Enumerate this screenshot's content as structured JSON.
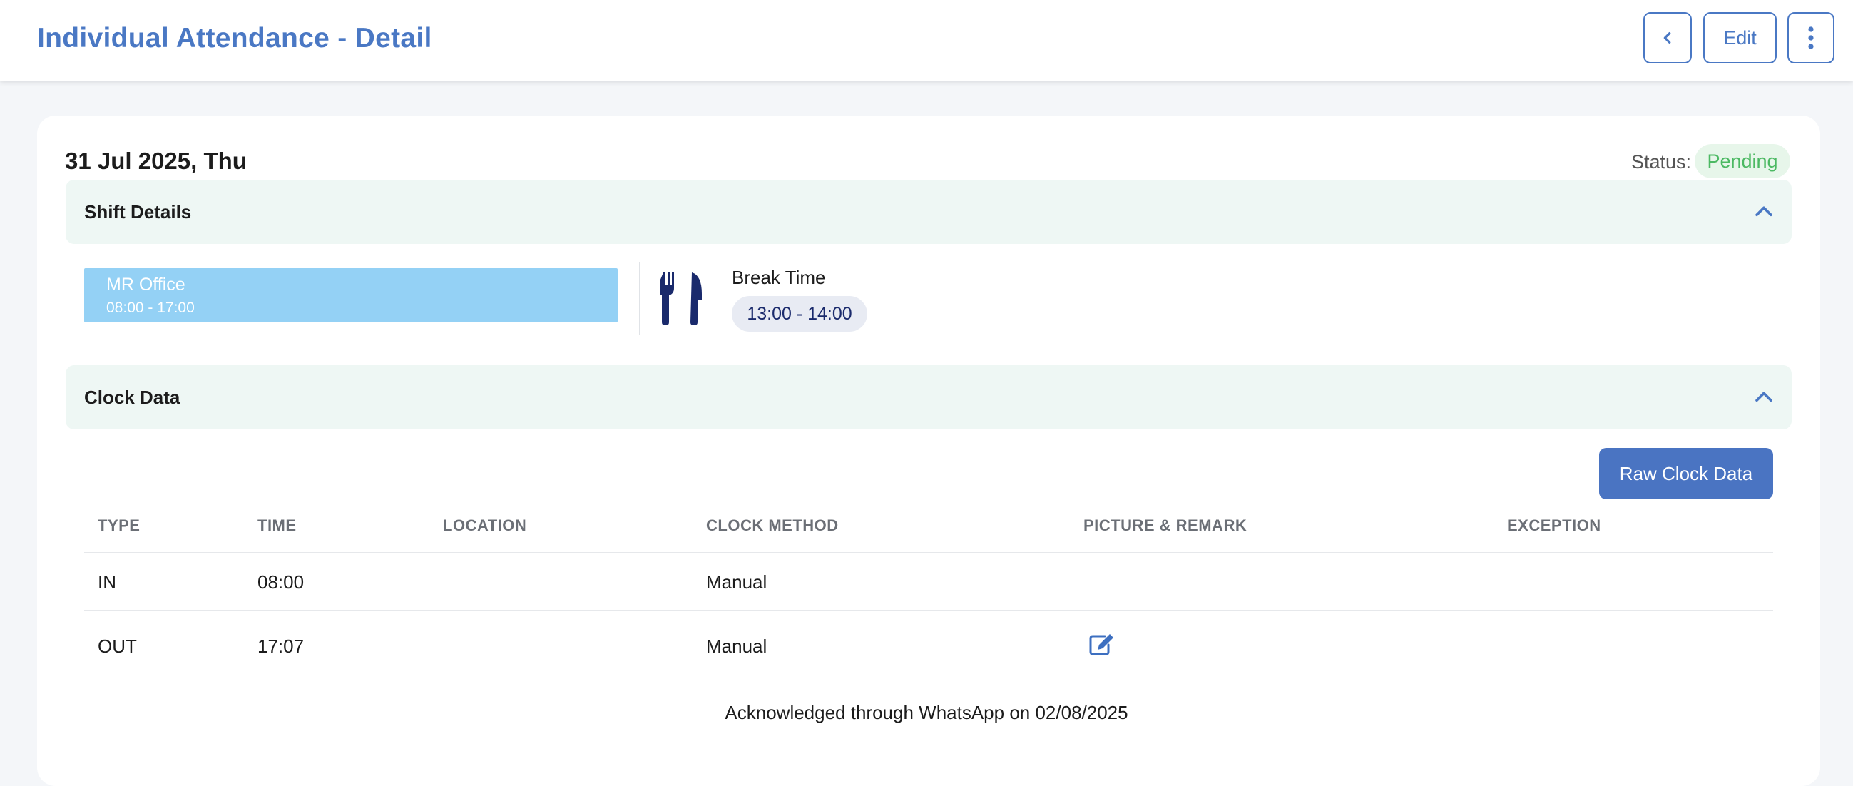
{
  "header": {
    "title": "Individual Attendance - Detail",
    "back_icon": "chevron-left-icon",
    "edit_label": "Edit",
    "more_icon": "vertical-dots-icon"
  },
  "record": {
    "date": "31 Jul 2025, Thu",
    "status_label": "Status:",
    "status_value": "Pending"
  },
  "shift_details": {
    "section_label": "Shift Details",
    "shift_name": "MR Office",
    "shift_time": "08:00 - 17:00",
    "break_label": "Break Time",
    "break_time": "13:00 - 14:00"
  },
  "clock_data": {
    "section_label": "Clock Data",
    "raw_button_label": "Raw Clock Data",
    "columns": [
      "TYPE",
      "TIME",
      "LOCATION",
      "CLOCK METHOD",
      "PICTURE & REMARK",
      "EXCEPTION"
    ],
    "rows": [
      {
        "type": "IN",
        "time": "08:00",
        "location": "",
        "method": "Manual",
        "remark_icon": "",
        "exception": ""
      },
      {
        "type": "OUT",
        "time": "17:07",
        "location": "",
        "method": "Manual",
        "remark_icon": "edit-note-icon",
        "exception": ""
      }
    ],
    "acknowledgement": "Acknowledged through WhatsApp on 02/08/2025"
  },
  "colors": {
    "accent": "#4a78c4",
    "status_pending_text": "#4cb963",
    "status_pending_bg": "#e7f6ea",
    "section_bg": "#eef7f4",
    "shift_block": "#94d1f5",
    "break_icon": "#1a2a6c"
  }
}
